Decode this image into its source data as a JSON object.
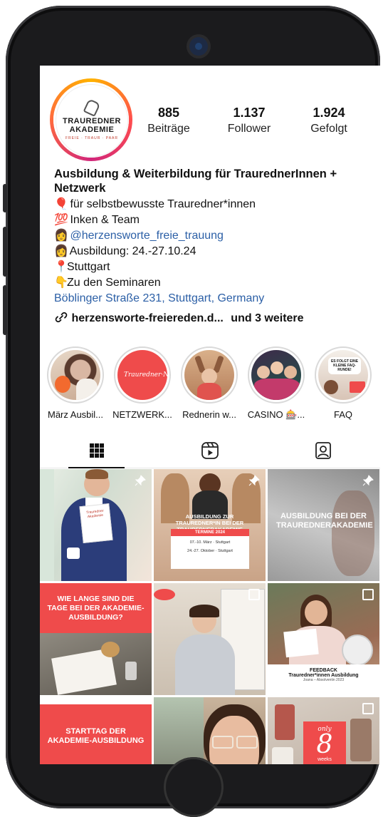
{
  "profile": {
    "avatar_brand_line1": "TRAUREDNER",
    "avatar_brand_line2": "AKADEMIE",
    "avatar_tagline": "FREIE · TRAUR · PAAR",
    "stats": [
      {
        "number": "885",
        "label": "Beiträge"
      },
      {
        "number": "1.137",
        "label": "Follower"
      },
      {
        "number": "1.924",
        "label": "Gefolgt"
      }
    ]
  },
  "bio": {
    "name": "Ausbildung & Weiterbildung für TraurednerInnen + Netzwerk",
    "lines": [
      {
        "emoji": "🎈",
        "text": "für selbstbewusste Trauredner*innen"
      },
      {
        "emoji": "💯",
        "text": "Inken & Team"
      },
      {
        "emoji": "👩",
        "text": "@herzensworte_freie_trauung"
      },
      {
        "emoji": "👩",
        "text": "Ausbildung: 24.-27.10.24"
      },
      {
        "emoji": "📍",
        "text": "Stuttgart"
      },
      {
        "emoji": "👇",
        "text": "Zu den Seminaren"
      }
    ],
    "address": "Böblinger Straße 231, Stuttgart, Germany",
    "website": "herzensworte-freiereden.d...",
    "website_more": "und 3 weitere"
  },
  "highlights": [
    {
      "label": "März Ausbil..."
    },
    {
      "label": "NETZWERK..."
    },
    {
      "label": "Rednerin w..."
    },
    {
      "label": "CASINO 🎰..."
    },
    {
      "label": "FAQ"
    }
  ],
  "highlight_texts": {
    "netzwerk_logo": "Trauredner·Netzwerk",
    "faq_bubble": "ES FOLGT EINE KLEINE FAQ-RUNDE!"
  },
  "tabs": [
    {
      "icon": "grid-icon"
    },
    {
      "icon": "reels-icon"
    },
    {
      "icon": "tagged-icon"
    }
  ],
  "posts": {
    "p1_card": "Trauredner Akademie",
    "p2_title": "AUSBILDUNG ZUR TRAUREDNER*IN BEI DER TRAUREDNERAKADEMIE",
    "p2_sub": "TERMINE 2024",
    "p2_row1": "07.-10. März · Stuttgart",
    "p2_row2": "24.-27. Oktober · Stuttgart",
    "p3_text": "AUSBILDUNG BEI DER TRAUREDNERAKADEMIE",
    "p4_text": "WIE LANGE SIND DIE TAGE BEI DER AKADEMIE-AUSBILDUNG?",
    "p6_title": "FEEDBACK",
    "p6_sub": "Trauredner*innen Ausbildung",
    "p6_small": "Joana – Absolventin 2023",
    "p7_text": "STARTTAG DER AKADEMIE-AUSBILDUNG",
    "p9_top": "only",
    "p9_big": "8",
    "p9_bottom": "weeks"
  },
  "colors": {
    "accent_red": "#ef4b4b",
    "link_blue": "#2b5fa6",
    "phone_frame": "#1b1b1d"
  }
}
